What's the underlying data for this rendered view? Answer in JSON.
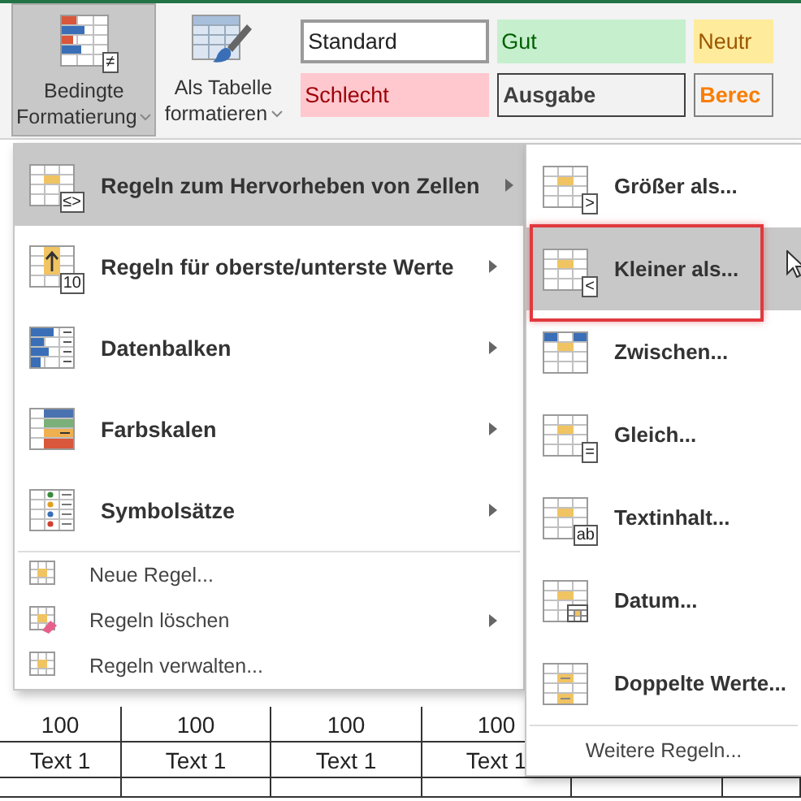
{
  "ribbon": {
    "buttons": [
      {
        "kind": "conditional_formatting",
        "lines": [
          "Bedingte",
          "Formatierung"
        ],
        "badge": "≠",
        "dropdown": true,
        "selected": true
      },
      {
        "kind": "format_as_table",
        "lines": [
          "Als Tabelle",
          "formatieren"
        ],
        "dropdown": true,
        "selected": false
      }
    ],
    "cell_styles": [
      {
        "label": "Standard",
        "kind": "standard"
      },
      {
        "label": "Gut",
        "kind": "good"
      },
      {
        "label": "Neutr",
        "kind": "neutral"
      },
      {
        "label": "Schlecht",
        "kind": "bad"
      },
      {
        "label": "Ausgabe",
        "kind": "output"
      },
      {
        "label": "Berec",
        "kind": "calculation"
      }
    ]
  },
  "sheet": {
    "rows": [
      [
        "100",
        "100",
        "100",
        "100"
      ],
      [
        "Text 1",
        "Text 1",
        "Text 1",
        "Text 1"
      ]
    ]
  },
  "menu": {
    "rule_types": [
      {
        "kind": "highlight",
        "label": "Regeln zum Hervorheben von Zellen",
        "badge": "≤>",
        "submenu": true,
        "selected": true
      },
      {
        "kind": "top_bottom",
        "label": "Regeln für oberste/unterste Werte",
        "badge": "10",
        "submenu": true,
        "selected": false
      },
      {
        "kind": "data_bars",
        "label": "Datenbalken",
        "submenu": true,
        "selected": false
      },
      {
        "kind": "color_scales",
        "label": "Farbskalen",
        "submenu": true,
        "selected": false
      },
      {
        "kind": "icon_sets",
        "label": "Symbolsätze",
        "submenu": true,
        "selected": false
      }
    ],
    "actions": [
      {
        "kind": "new_rule",
        "label": "Neue Regel...",
        "submenu": false
      },
      {
        "kind": "clear_rules",
        "label": "Regeln löschen",
        "submenu": true
      },
      {
        "kind": "manage_rules",
        "label": "Regeln verwalten...",
        "submenu": false
      }
    ]
  },
  "submenu": {
    "items": [
      {
        "kind": "compare",
        "label": "Größer als...",
        "badge": ">",
        "selected": false
      },
      {
        "kind": "compare",
        "label": "Kleiner als...",
        "badge": "<",
        "selected": true
      },
      {
        "kind": "between",
        "label": "Zwischen...",
        "selected": false
      },
      {
        "kind": "compare",
        "label": "Gleich...",
        "badge": "=",
        "selected": false
      },
      {
        "kind": "compare",
        "label": "Textinhalt...",
        "badge": "ab",
        "selected": false
      },
      {
        "kind": "date",
        "label": "Datum...",
        "selected": false
      },
      {
        "kind": "duplicate",
        "label": "Doppelte Werte...",
        "selected": false
      }
    ],
    "footer": "Weitere Regeln..."
  }
}
